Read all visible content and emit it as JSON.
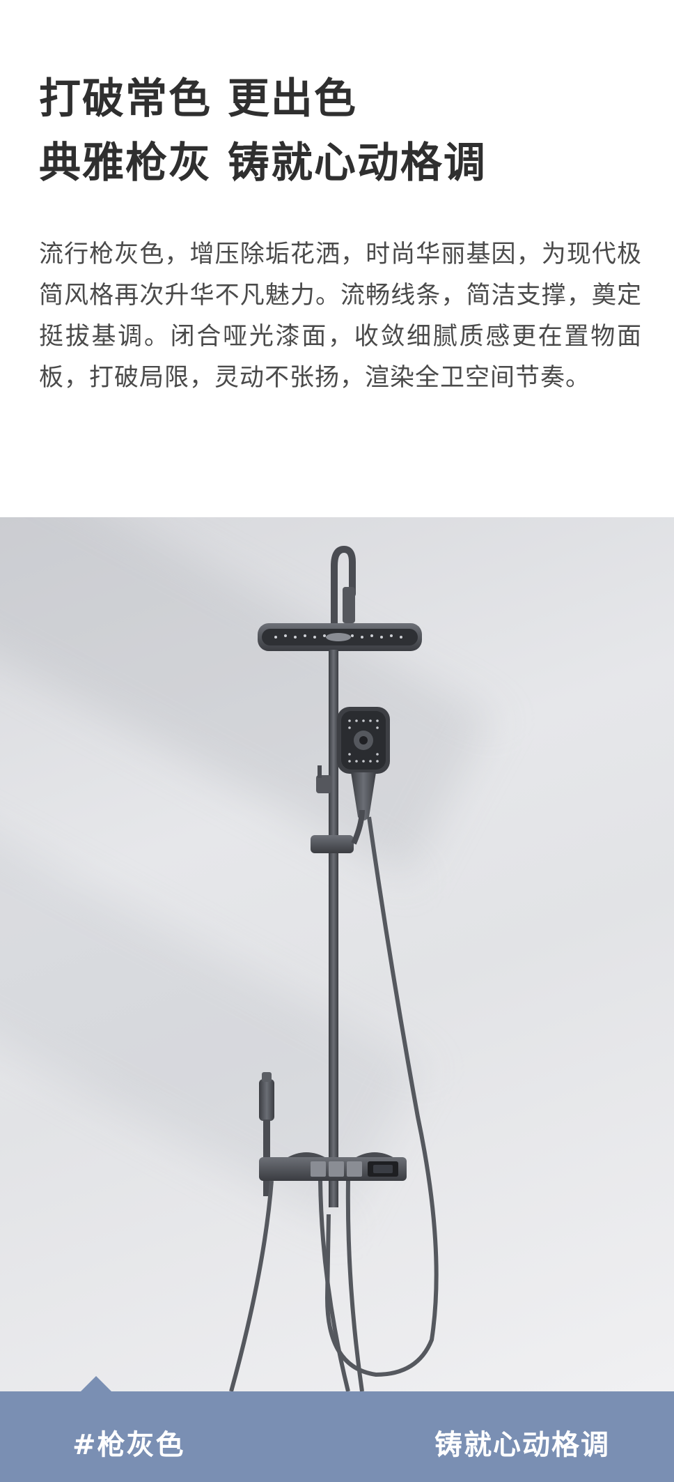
{
  "headline": {
    "line1": "打破常色 更出色",
    "line2": "典雅枪灰 铸就心动格调"
  },
  "description": "流行枪灰色，增压除垢花洒，时尚华丽基因，为现代极简风格再次升华不凡魅力。流畅线条，简洁支撑，奠定挺拔基调。闭合哑光漆面，收敛细腻质感更在置物面板，打破局限，灵动不张扬，渲染全卫空间节奏。",
  "footer": {
    "left_label": "#枪灰色",
    "right_label": "铸就心动格调"
  },
  "colors": {
    "footer_bar": "#7a8fb3",
    "headline": "#2f2f2f",
    "body_text": "#4a4a4a",
    "background_panel": "#e2e3e6",
    "fixture": "#4a4c52"
  },
  "icons": {
    "product_image": "shower-system-image"
  }
}
